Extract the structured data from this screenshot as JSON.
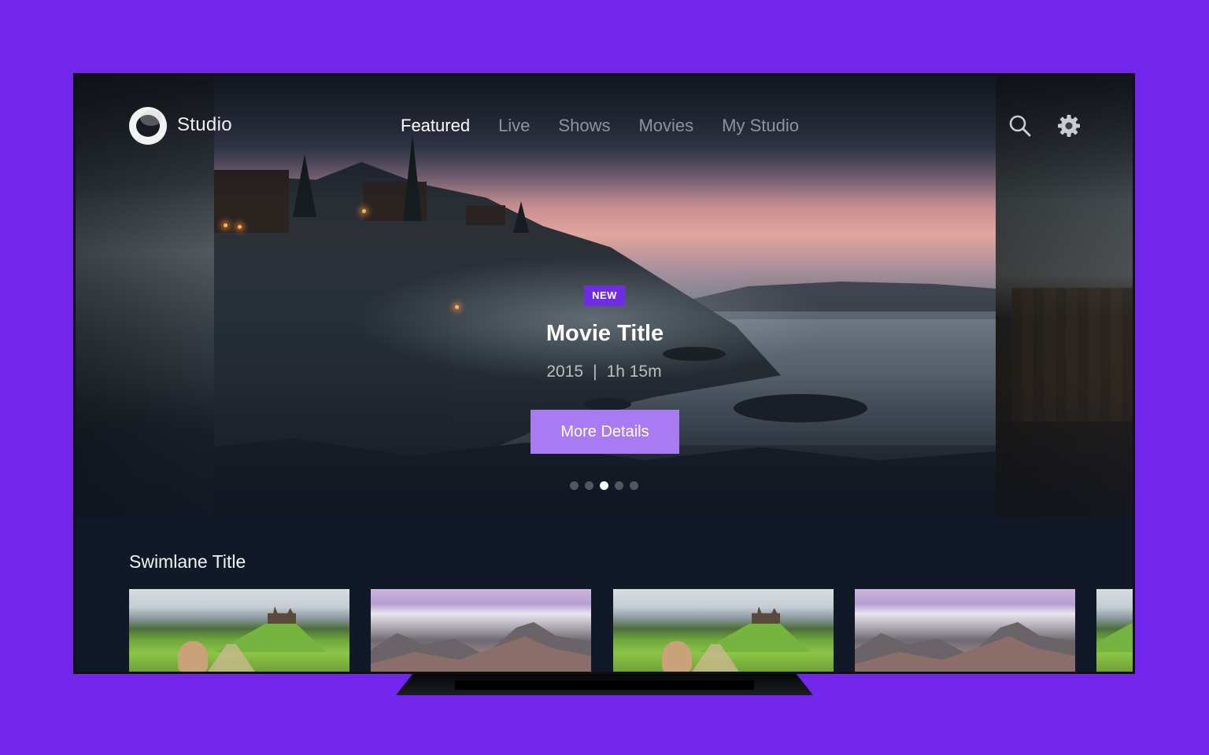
{
  "brand": {
    "name": "Studio",
    "logo_icon": "studio-logo-icon"
  },
  "nav": {
    "items": [
      {
        "label": "Featured",
        "active": true
      },
      {
        "label": "Live",
        "active": false
      },
      {
        "label": "Shows",
        "active": false
      },
      {
        "label": "Movies",
        "active": false
      },
      {
        "label": "My Studio",
        "active": false
      }
    ],
    "search_icon": "search-icon",
    "settings_icon": "gear-icon"
  },
  "hero": {
    "badge": "NEW",
    "title": "Movie Title",
    "year": "2015",
    "separator": "|",
    "duration": "1h 15m",
    "button_label": "More Details",
    "carousel": {
      "count": 5,
      "active_index": 2
    }
  },
  "swimlane": {
    "title": "Swimlane Title",
    "tiles": [
      {
        "scene": "green-hill"
      },
      {
        "scene": "mountains"
      },
      {
        "scene": "green-hill"
      },
      {
        "scene": "mountains"
      },
      {
        "scene": "green-hill"
      }
    ]
  },
  "colors": {
    "background": "#7327ed",
    "accent": "#6e2de3",
    "button": "#a87bf3",
    "screen": "#111827"
  }
}
